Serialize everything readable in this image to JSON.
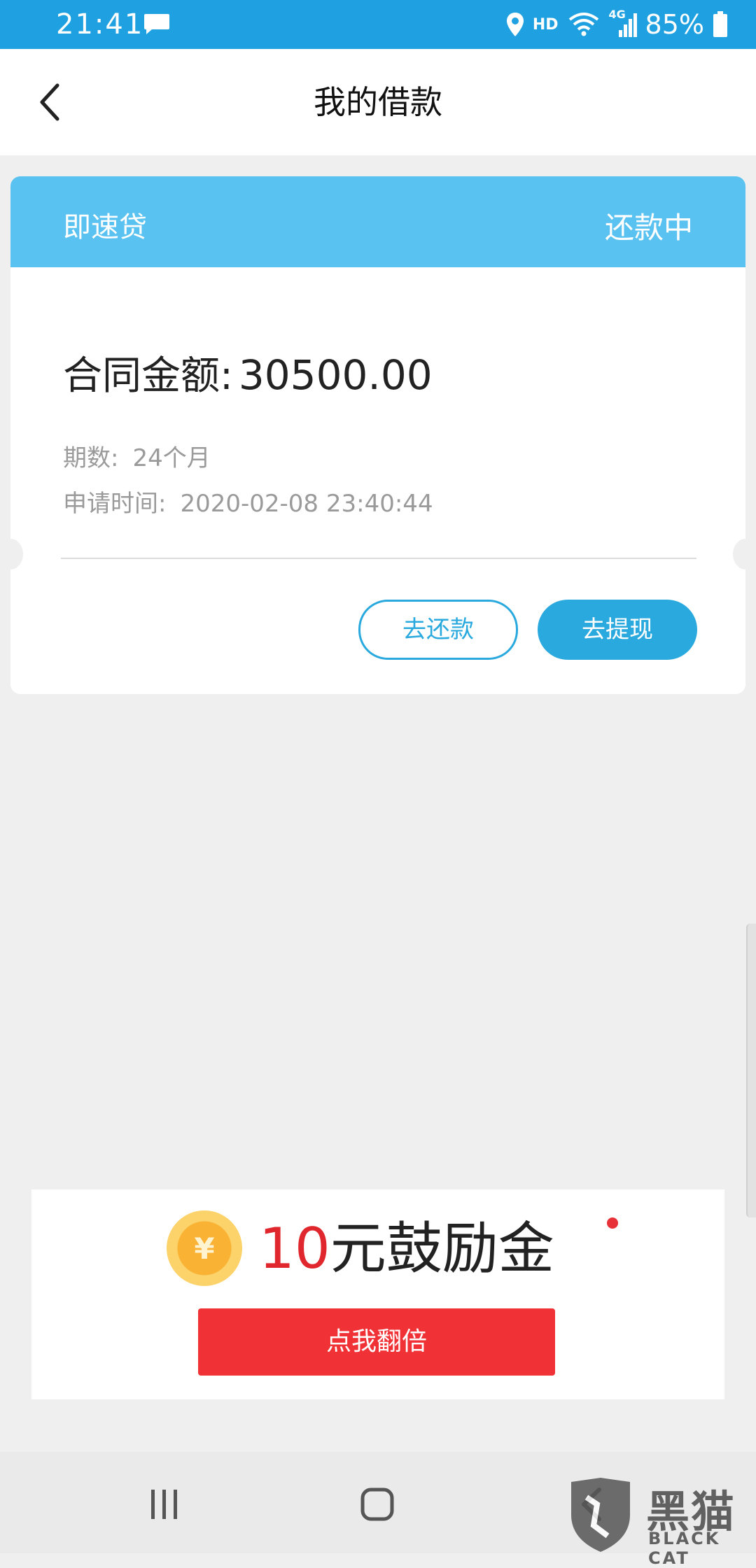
{
  "status_bar": {
    "time": "21:41",
    "network": "HD",
    "signal_label": "4G",
    "battery": "85%"
  },
  "header": {
    "title": "我的借款"
  },
  "loan_card": {
    "product_name": "即速贷",
    "status": "还款中",
    "amount_label": "合同金额:",
    "amount_value": "30500.00",
    "periods_label": "期数:",
    "periods_value": "24个月",
    "apply_time_label": "申请时间:",
    "apply_time_value": "2020-02-08 23:40:44",
    "repay_button": "去还款",
    "withdraw_button": "去提现"
  },
  "promo": {
    "coin_symbol": "¥",
    "amount": "10",
    "title_rest": "元鼓励金",
    "button": "点我翻倍"
  },
  "watermark": {
    "cn": "黑猫",
    "en": "BLACK CAT"
  },
  "colors": {
    "status_bar": "#1fa0e0",
    "card_header": "#5ac2f0",
    "accent_blue": "#2aa9de",
    "promo_red": "#f03236"
  }
}
